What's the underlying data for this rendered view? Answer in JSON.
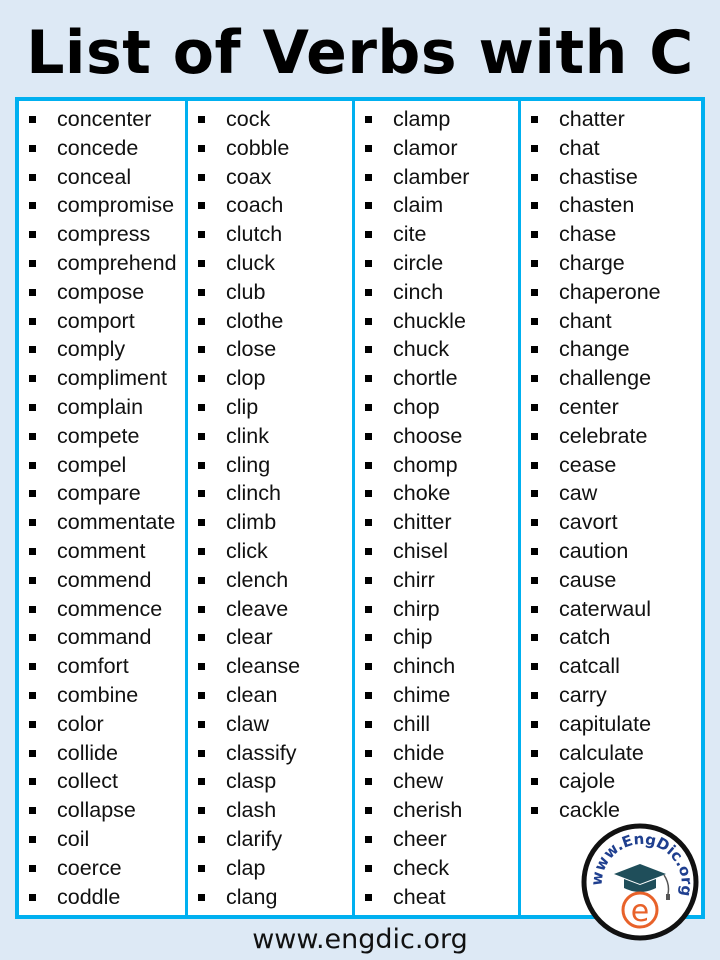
{
  "title": "List of Verbs with C",
  "columns": [
    [
      "concenter",
      "concede",
      "conceal",
      "compromise",
      "compress",
      "comprehend",
      "compose",
      "comport",
      "comply",
      "compliment",
      "complain",
      "compete",
      "compel",
      "compare",
      "commentate",
      "comment",
      "commend",
      "commence",
      "command",
      "comfort",
      "combine",
      "color",
      "collide",
      "collect",
      "collapse",
      "coil",
      "coerce",
      "coddle"
    ],
    [
      "cock",
      "cobble",
      "coax",
      "coach",
      "clutch",
      "cluck",
      "club",
      "clothe",
      "close",
      "clop",
      "clip",
      "clink",
      "cling",
      "clinch",
      "climb",
      "click",
      "clench",
      "cleave",
      "clear",
      "cleanse",
      "clean",
      "claw",
      "classify",
      "clasp",
      "clash",
      "clarify",
      "clap",
      "clang"
    ],
    [
      "clamp",
      "clamor",
      "clamber",
      "claim",
      "cite",
      "circle",
      "cinch",
      "chuckle",
      "chuck",
      "chortle",
      "chop",
      "choose",
      "chomp",
      "choke",
      "chitter",
      "chisel",
      "chirr",
      "chirp",
      "chip",
      "chinch",
      "chime",
      "chill",
      "chide",
      "chew",
      "cherish",
      "cheer",
      "check",
      "cheat"
    ],
    [
      "chatter",
      "chat",
      "chastise",
      "chasten",
      "chase",
      "charge",
      "chaperone",
      "chant",
      "change",
      "challenge",
      "center",
      "celebrate",
      "cease",
      "caw",
      "cavort",
      "caution",
      "cause",
      "caterwaul",
      "catch",
      "catcall",
      "carry",
      "capitulate",
      "calculate",
      "cajole",
      "cackle"
    ]
  ],
  "logo": {
    "text": "www.EngDic.org",
    "letter": "e",
    "icon": "graduation-cap-icon"
  },
  "footer": "www.engdic.org",
  "colors": {
    "background": "#dde9f5",
    "border": "#00b0f0",
    "logo_cap": "#1f4e5a",
    "logo_letter": "#e8622a",
    "logo_text": "#1f3f8f"
  }
}
